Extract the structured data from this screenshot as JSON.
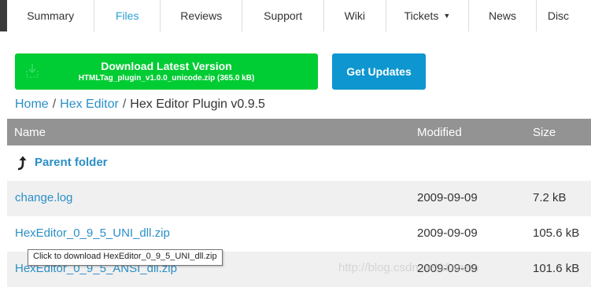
{
  "tabs": [
    {
      "label": "Summary",
      "active": false
    },
    {
      "label": "Files",
      "active": true
    },
    {
      "label": "Reviews",
      "active": false
    },
    {
      "label": "Support",
      "active": false
    },
    {
      "label": "Wiki",
      "active": false
    },
    {
      "label": "Tickets",
      "active": false,
      "dropdown": true
    },
    {
      "label": "News",
      "active": false
    },
    {
      "label": "Disc",
      "active": false
    }
  ],
  "download": {
    "title": "Download Latest Version",
    "subtitle": "HTMLTag_plugin_v1.0.0_unicode.zip (365.0 kB)",
    "color": "#00cc33"
  },
  "updates_button": {
    "label": "Get Updates",
    "color": "#0d96cf"
  },
  "breadcrumb": {
    "home": "Home",
    "sep1": "/",
    "section": "Hex Editor",
    "sep2": "/",
    "current": "Hex Editor Plugin v0.9.5"
  },
  "table": {
    "headers": {
      "name": "Name",
      "modified": "Modified",
      "size": "Size"
    },
    "parent_label": "Parent folder",
    "rows": [
      {
        "name": "change.log",
        "modified": "2009-09-09",
        "size": "7.2 kB"
      },
      {
        "name": "HexEditor_0_9_5_UNI_dll.zip",
        "modified": "2009-09-09",
        "size": "105.6 kB"
      },
      {
        "name": "HexEditor_0_9_5_ANSI_dll.zip",
        "modified": "2009-09-09",
        "size": "101.6 kB"
      }
    ]
  },
  "tooltip": "Click to download HexEditor_0_9_5_UNI_dll.zip",
  "watermark": "http://blog.csdn.net/dianxin",
  "colors": {
    "link": "#2a8fc7",
    "active_tab": "#2a9fd6",
    "header_bg": "#939393"
  },
  "icons": {
    "download": "download-arrows-icon",
    "parent": "turn-up-arrow-icon",
    "tickets": "caret-down-icon"
  }
}
